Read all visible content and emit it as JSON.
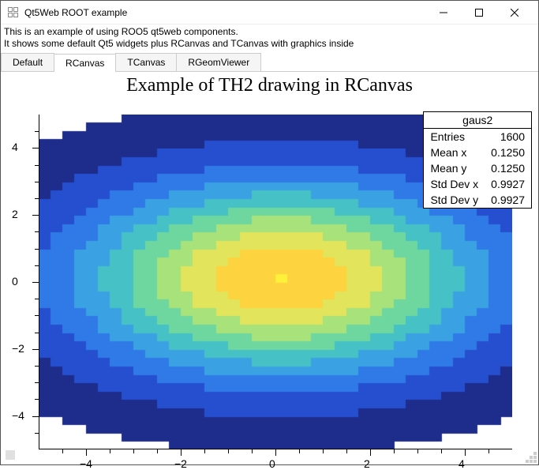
{
  "window": {
    "title": "Qt5Web ROOT example"
  },
  "description": {
    "line1": "This is an example of using ROO5 qt5web components.",
    "line2": "It shows some default Qt5 widgets plus RCanvas and TCanvas with graphics inside"
  },
  "tabs": [
    {
      "label": "Default"
    },
    {
      "label": "RCanvas"
    },
    {
      "label": "TCanvas"
    },
    {
      "label": "RGeomViewer"
    }
  ],
  "chart": {
    "title": "Example of TH2 drawing in RCanvas"
  },
  "stats": {
    "name": "gaus2",
    "rows": [
      {
        "k": "Entries",
        "v": "1600"
      },
      {
        "k": "Mean x",
        "v": "0.1250"
      },
      {
        "k": "Mean y",
        "v": "0.1250"
      },
      {
        "k": "Std Dev x",
        "v": "0.9927"
      },
      {
        "k": "Std Dev y",
        "v": "0.9927"
      }
    ]
  },
  "axes": {
    "x_ticks": [
      "−4",
      "−2",
      "0",
      "2",
      "4"
    ],
    "y_ticks": [
      "−4",
      "−2",
      "0",
      "2",
      "4"
    ]
  },
  "chart_data": {
    "type": "heatmap",
    "title": "Example of TH2 drawing in RCanvas",
    "xlabel": "",
    "ylabel": "",
    "xlim": [
      -5,
      5
    ],
    "ylim": [
      -5,
      5
    ],
    "nbinsx": 40,
    "nbinsy": 40,
    "mean_x": 0.125,
    "mean_y": 0.125,
    "sigma_x": 0.9927,
    "sigma_y": 0.9927,
    "entries": 1600,
    "colorscale": [
      "#ffffff",
      "#1e2c8c",
      "#254fcf",
      "#2f7ae6",
      "#3aa2e2",
      "#46c1c5",
      "#6ed7a0",
      "#a8e27a",
      "#e2e55c",
      "#fdd33f",
      "#fff03a"
    ]
  }
}
